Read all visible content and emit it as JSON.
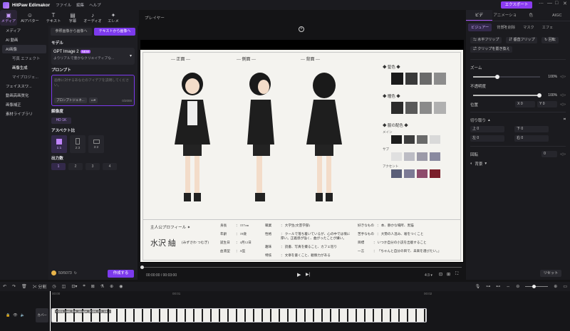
{
  "titlebar": {
    "app": "HitPaw Edimakor",
    "menus": [
      "ファイル",
      "編集",
      "ヘルプ"
    ],
    "export": "エクスポート"
  },
  "tools": [
    {
      "label": "メディア",
      "icon": "media-icon"
    },
    {
      "label": "AIアバター",
      "icon": "avatar-icon"
    },
    {
      "label": "テキスト",
      "icon": "text-icon"
    },
    {
      "label": "字幕",
      "icon": "subtitle-icon"
    },
    {
      "label": "オーディオ",
      "icon": "audio-icon"
    },
    {
      "label": "エレメ",
      "icon": "element-icon"
    }
  ],
  "leftnav": {
    "items": [
      "メディア",
      "AI 動画",
      "AI画像",
      "写真 エフェクト",
      "画像生成",
      "マイプロジェ...",
      "フェイススワ...",
      "動画高画質化",
      "画像補正",
      "素材ライブラリ"
    ]
  },
  "panel": {
    "tabs": [
      "参照画像から画像へ",
      "テキストから画像へ"
    ],
    "model_label": "モデル",
    "model_name": "GPT Image 2",
    "model_badge": "NEW",
    "model_desc": "よりリアルで豊かなクリエイティブな...",
    "prompt_label": "プロンプト",
    "prompt_placeholder": "画像に対するあなたのアイデアを説明してください。",
    "prompt_guide": "プロンプトジェネ...",
    "prompt_count": "0/2000",
    "res_label": "解像度",
    "res_value": "HD 1K",
    "aspect_label": "アスペクト比",
    "aspects": [
      "1:1",
      "2:3",
      "3:2"
    ],
    "count_label": "出力数",
    "counts": [
      "1",
      "2",
      "3",
      "4"
    ],
    "credits": "50/5073",
    "generate": "作成する"
  },
  "player": {
    "title": "プレイヤー",
    "time": "00:00:00 / 00:03:00",
    "ratio": "4:3"
  },
  "sheet": {
    "views": [
      "正面",
      "側面",
      "背面"
    ],
    "palette": {
      "hair": "髪色",
      "eyes": "瞳色",
      "outfit": "服の配色",
      "main": "メイン",
      "sub": "サブ",
      "accent": "アクセント"
    },
    "colors": {
      "hair": [
        "#1a1a1a",
        "#3a3a3a",
        "#6a6a6a",
        "#8c8c8c"
      ],
      "eyes": [
        "#2b2b2b",
        "#5a5a5a",
        "#8a8a8a",
        "#b0b0b0"
      ],
      "main": [
        "#1c1c1c",
        "#3d3d3d",
        "#6a6a6a",
        "#d9d9d9"
      ],
      "sub": [
        "#e0e0e0",
        "#bcbcc4",
        "#9c9aa8",
        "#8a8aa0"
      ],
      "accent": [
        "#5a5e78",
        "#7c7a95",
        "#8d4b6b",
        "#7a1e2a"
      ]
    },
    "profile_title": "主人公プロフィール",
    "name": "水沢 紬",
    "reading": "(みずさわ つむぎ)",
    "fields": [
      [
        "身長",
        "157cm"
      ],
      [
        "年齢",
        "19歳"
      ],
      [
        "誕生日",
        "4月12日"
      ],
      [
        "血液型",
        "A型"
      ]
    ],
    "fields2": [
      [
        "職業",
        "大学生(文芸学部)"
      ],
      [
        "性格",
        "クールで落ち着いているが、心の中では情に厚い。正義感が強く、曲がったことが嫌い。"
      ],
      [
        "趣味",
        "読書、写真を撮ること、カフェ巡り"
      ],
      [
        "特技",
        "文章を書くこと、観察力がある"
      ]
    ],
    "fields3": [
      [
        "好きなもの",
        "本、静かな場所、黒猫"
      ],
      [
        "苦手なもの",
        "大勢の人混み、嘘をつくこと"
      ],
      [
        "目標",
        "いつか自分の小説を出版すること"
      ],
      [
        "一言",
        "「ちゃんと自分の目で、未来を選びたい。」"
      ]
    ]
  },
  "right": {
    "tabs": [
      "ビデ",
      "アニメーション",
      "色",
      "AIGC"
    ],
    "subtabs": [
      "ビジュアー",
      "背景を削除",
      "マスク",
      "エフェ"
    ],
    "flip_h": "水平フリップ",
    "flip_v": "垂直フリップ",
    "rotate": "回転",
    "replace": "クリップを置き換え",
    "zoom_label": "ズーム",
    "zoom": "100%",
    "opacity_label": "不透明度",
    "opacity": "100%",
    "position_label": "位置",
    "x": "0",
    "y": "0",
    "crop_label": "切り取り",
    "crop": {
      "top": "0",
      "bottom": "0",
      "left": "0",
      "right": "0"
    },
    "crop_labels": {
      "top": "上",
      "bottom": "下",
      "left": "左",
      "right": "右"
    },
    "rotation_label": "回転",
    "rotation": "0",
    "bg_label": "背景",
    "reset": "リセット"
  },
  "timeline": {
    "split": "分割",
    "ticks": [
      "00:00",
      "00:01",
      "00:02"
    ],
    "cover": "カバー",
    "clip": "GO1_test_file_image_2026_03_19..."
  }
}
